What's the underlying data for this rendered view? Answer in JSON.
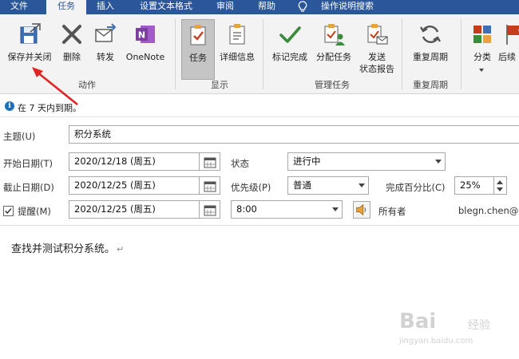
{
  "menu": {
    "tabs": [
      {
        "label": "文件"
      },
      {
        "label": "任务"
      },
      {
        "label": "插入"
      },
      {
        "label": "设置文本格式"
      },
      {
        "label": "审阅"
      },
      {
        "label": "帮助"
      }
    ],
    "tell_me": "操作说明搜索",
    "active_tab": "任务"
  },
  "ribbon": {
    "buttons": {
      "save_close": "保存并关闭",
      "delete": "删除",
      "forward": "转发",
      "onenote": "OneNote",
      "task": "任务",
      "details": "详细信息",
      "mark_complete": "标记完成",
      "assign_task": "分配任务",
      "send_status": "发送\n状态报告",
      "recurrence": "重复周期",
      "categorize": "分类",
      "follow_up": "后续"
    },
    "groups": {
      "actions": "动作",
      "show": "显示",
      "manage": "管理任务",
      "recurrence": "重复周期"
    },
    "colors": {
      "blue": "#2b579a",
      "green": "#3c8a3c",
      "purple": "#7b3fa0",
      "red": "#c43e1c",
      "orange": "#e8a33b"
    }
  },
  "info": {
    "message": "在 7 天内到期。"
  },
  "form": {
    "subject_label": "主题(U)",
    "subject_value": "积分系统",
    "start_label": "开始日期(T)",
    "start_value": "2020/12/18 (周五)",
    "status_label": "状态",
    "status_value": "进行中",
    "due_label": "截止日期(D)",
    "due_value": "2020/12/25 (周五)",
    "priority_label": "优先级(P)",
    "priority_value": "普通",
    "percent_label": "完成百分比(C)",
    "percent_value": "25%",
    "reminder_label": "提醒(M)",
    "reminder_checked": true,
    "reminder_date": "2020/12/25 (周五)",
    "reminder_time": "8:00",
    "owner_label": "所有者",
    "owner_value": "blegn.chen@"
  },
  "body": {
    "text": "查找并测试积分系统。",
    "paragraph_mark": "↵"
  },
  "watermark": {
    "brand": "Bai",
    "brand2": "经验",
    "url": "jingyan.baidu.com"
  }
}
